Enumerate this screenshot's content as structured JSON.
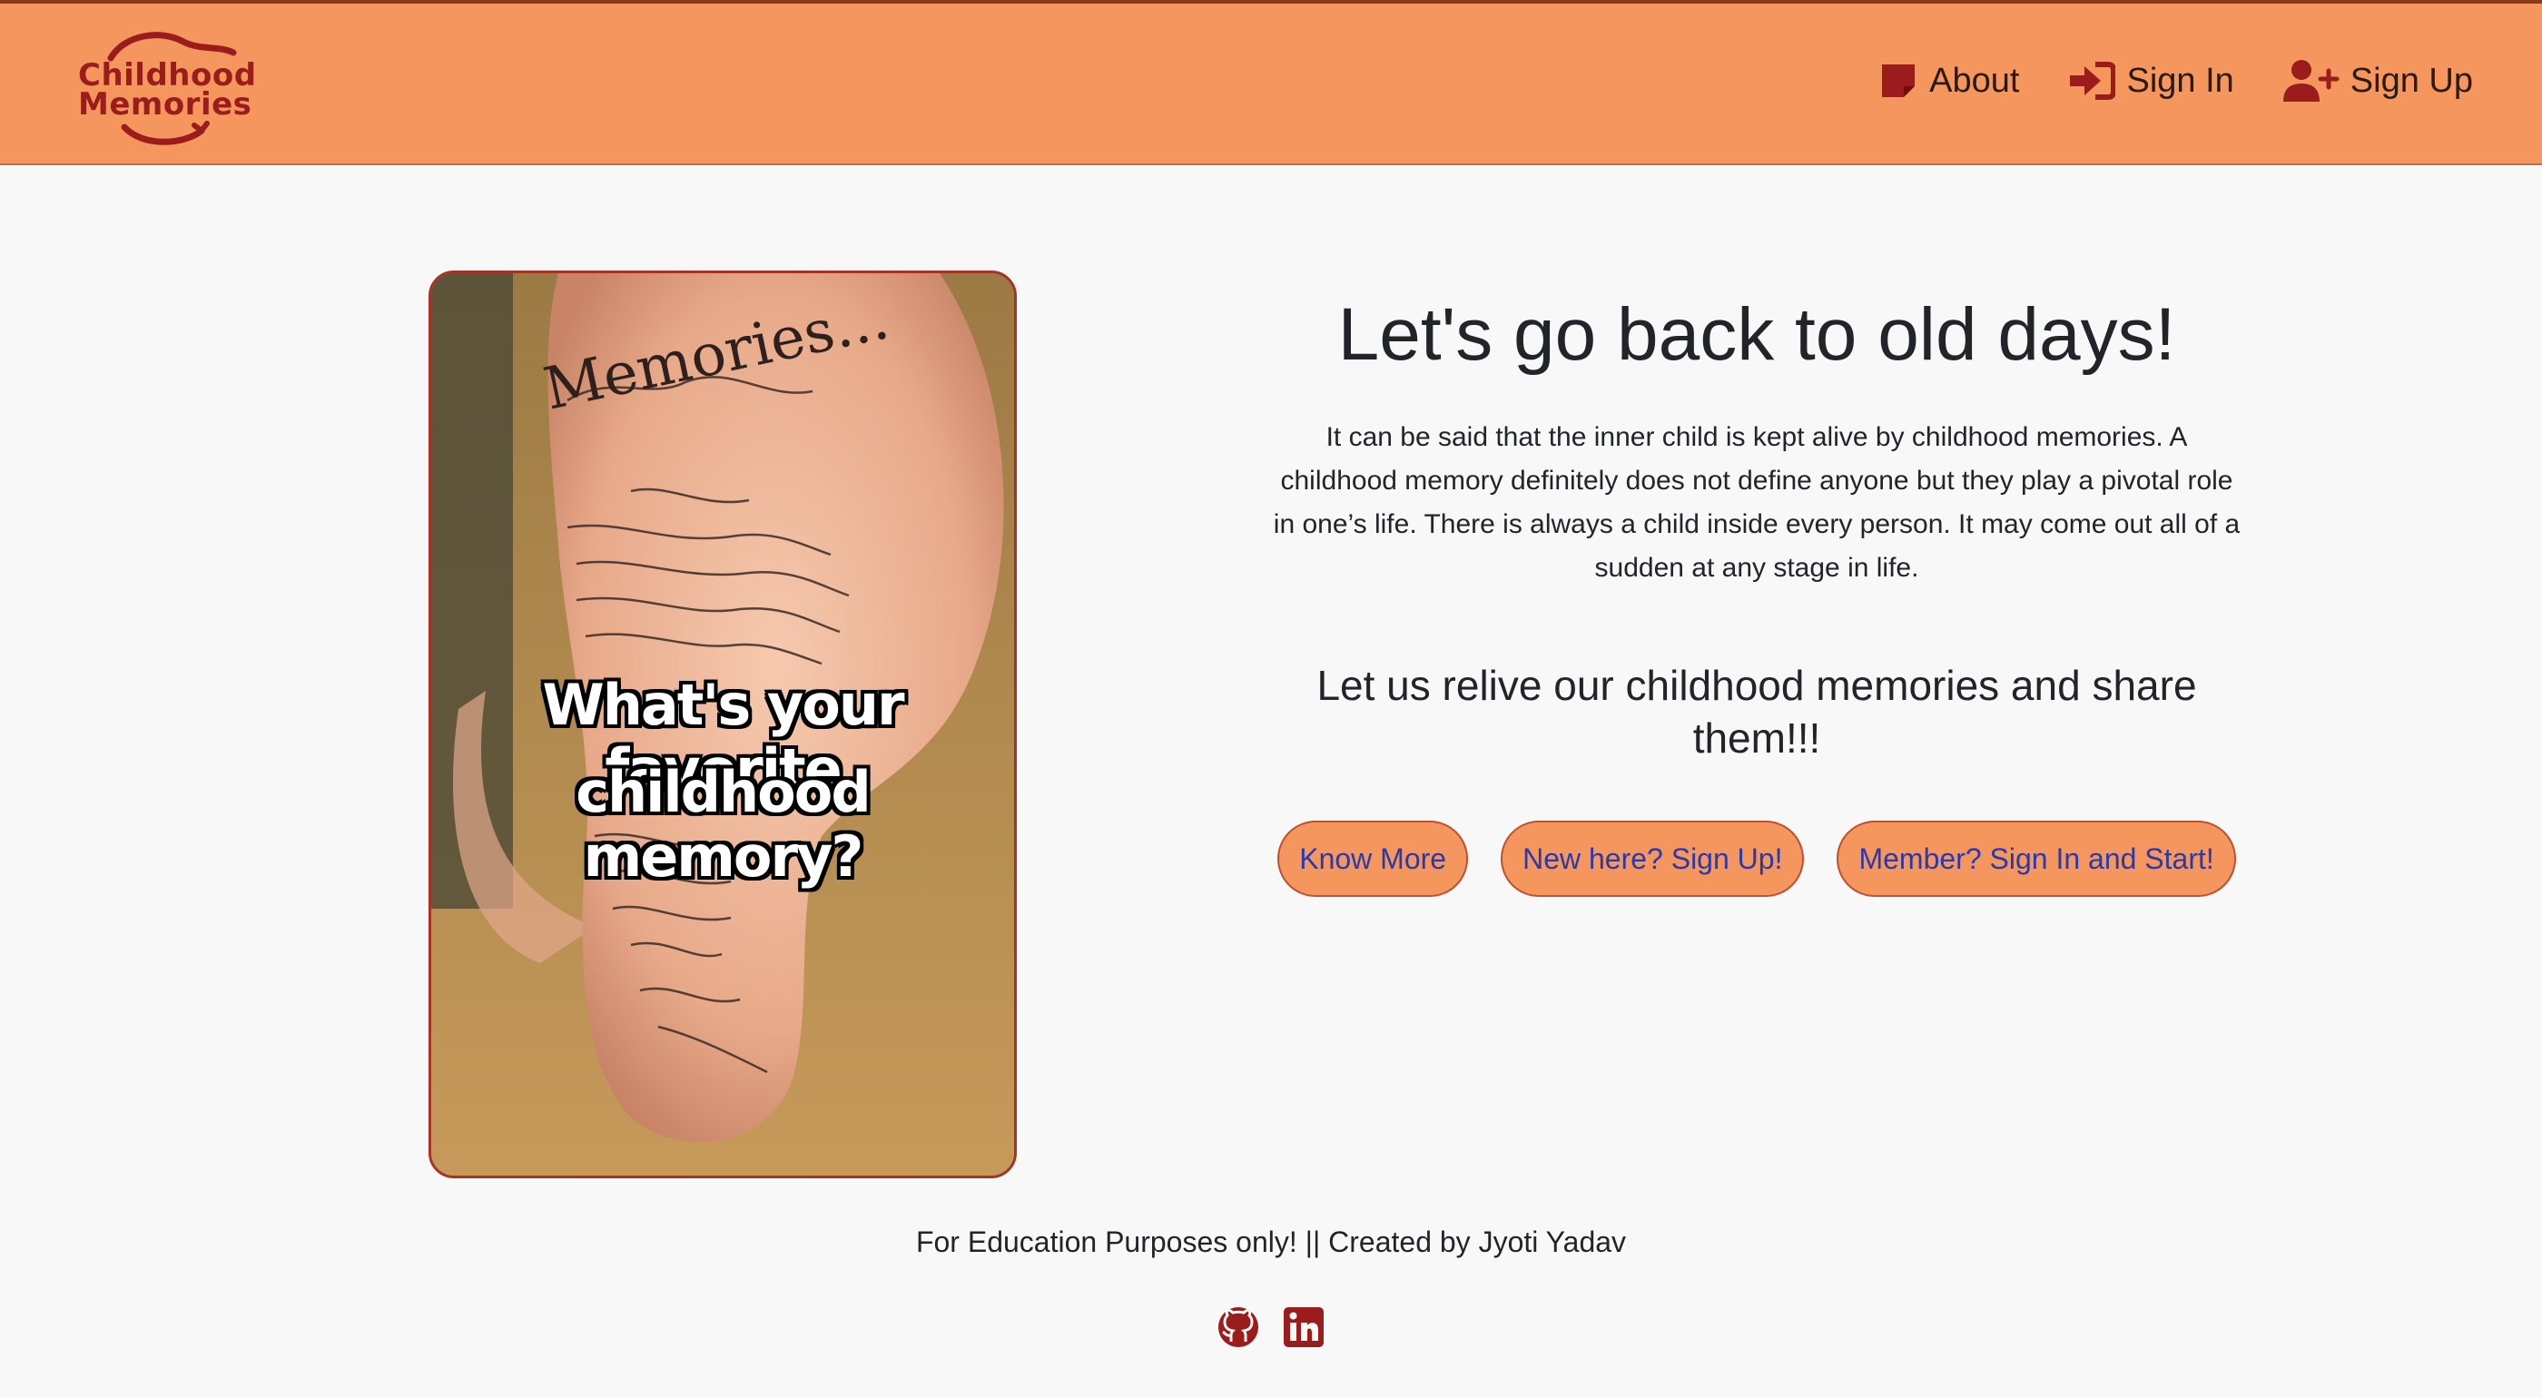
{
  "brand": {
    "line1": "Childhood",
    "line2": "Memories",
    "color": "#9b1c1c"
  },
  "nav": {
    "items": [
      {
        "label": "About",
        "icon": "note-icon"
      },
      {
        "label": "Sign In",
        "icon": "sign-in-icon"
      },
      {
        "label": "Sign Up",
        "icon": "user-plus-icon"
      }
    ],
    "background": "#f4965e"
  },
  "hero": {
    "image_caption_line1": "What's your favorite",
    "image_caption_line2": "childhood memory?",
    "image_handwriting": "Memories...",
    "headline": "Let's go back to old days!",
    "lead": "It can be said that the inner child is kept alive by childhood memories. A childhood memory definitely does not define anyone but they play a pivotal role in one’s life. There is always a child inside every person. It may come out all of a sudden at any stage in life.",
    "subheadline": "Let us relive our childhood memories and share them!!!",
    "buttons": [
      {
        "label": "Know More"
      },
      {
        "label": "New here? Sign Up!"
      },
      {
        "label": "Member? Sign In and Start!"
      }
    ]
  },
  "footer": {
    "text": "For Education Purposes only! || Created by Jyoti Yadav",
    "icons": [
      "github-icon",
      "linkedin-icon"
    ]
  }
}
